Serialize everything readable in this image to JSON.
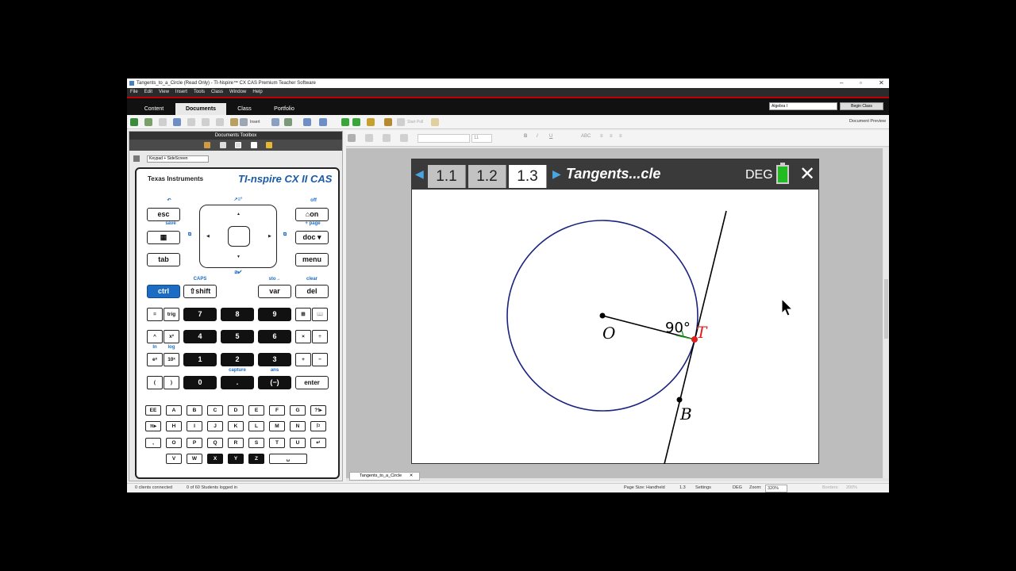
{
  "window": {
    "title": "Tangents_to_a_Circle (Read Only) - TI-Nspire™ CX CAS Premium Teacher Software",
    "controls": [
      "–",
      "▫",
      "✕"
    ]
  },
  "menu": [
    "File",
    "Edit",
    "View",
    "Insert",
    "Tools",
    "Class",
    "Window",
    "Help"
  ],
  "main_tabs": [
    {
      "label": "Content",
      "active": false
    },
    {
      "label": "Documents",
      "active": true
    },
    {
      "label": "Class",
      "active": false
    },
    {
      "label": "Portfolio",
      "active": false
    }
  ],
  "class_select": "Algebra I",
  "begin_class": "Begin Class",
  "toolbar": {
    "insert_label": "Insert",
    "start_poll": "Start Poll",
    "document_preview": "Document Preview"
  },
  "toolbox": {
    "title": "Documents Toolbox",
    "keypad_select": "Keypad + SideScreen"
  },
  "keypad": {
    "brand": "Texas Instruments",
    "model": "TI-nspire CX II CAS",
    "keys": {
      "esc": "esc",
      "on": "on",
      "doc": "doc",
      "tab": "tab",
      "menu": "menu",
      "ctrl": "ctrl",
      "shift": "shift",
      "var": "var",
      "del": "del",
      "equals": "=",
      "trig": "trig",
      "seven": "7",
      "eight": "8",
      "nine": "9",
      "caret": "^",
      "x2": "x²",
      "four": "4",
      "five": "5",
      "six": "6",
      "times": "×",
      "divide": "÷",
      "ex": "eˣ",
      "tenx": "10ˣ",
      "one": "1",
      "two": "2",
      "three": "3",
      "plus": "+",
      "minus": "−",
      "lparen": "(",
      "rparen": ")",
      "zero": "0",
      "dot": ".",
      "neg": "(−)",
      "enter": "enter"
    },
    "labels": {
      "off": "off",
      "save": "save",
      "page": "+ page",
      "caps": "CAPS",
      "sto": "sto→",
      "clear": "clear",
      "ln": "ln",
      "log": "log",
      "capture": "capture",
      "ans": "ans"
    },
    "alpha_rows": [
      [
        "EE",
        "A",
        "B",
        "C",
        "D",
        "E",
        "F",
        "G",
        "?!▸"
      ],
      [
        "π▸",
        "H",
        "I",
        "J",
        "K",
        "L",
        "M",
        "N",
        "⚐"
      ],
      [
        ",",
        "O",
        "P",
        "Q",
        "R",
        "S",
        "T",
        "U",
        "↵"
      ],
      [
        "V",
        "W",
        "X",
        "Y",
        "Z",
        "␣"
      ]
    ]
  },
  "formatting": {
    "font_size": "11"
  },
  "handheld": {
    "pages": [
      {
        "label": "1.1",
        "active": false
      },
      {
        "label": "1.2",
        "active": false
      },
      {
        "label": "1.3",
        "active": true
      }
    ],
    "doc_name": "Tangents...cle",
    "angle_mode": "DEG",
    "geometry": {
      "point_o": "O",
      "point_t": "T",
      "point_b": "B",
      "angle_label": "90°"
    },
    "colors": {
      "circle": "#1a237e",
      "tangent_point": "#e02020",
      "radius": "#000000",
      "right_angle": "#22aa22"
    }
  },
  "doc_tab": "Tangents_to_a_Circle",
  "status": {
    "clients": "0 clients connected",
    "students": "0 of 60 Students logged in",
    "page_size": "Page Size: Handheld",
    "page_num": "1.3",
    "settings": "Settings",
    "angle": "DEG",
    "zoom_label": "Zoom:",
    "zoom": "320%",
    "borders": "Borders:",
    "borders_value": "200%"
  }
}
